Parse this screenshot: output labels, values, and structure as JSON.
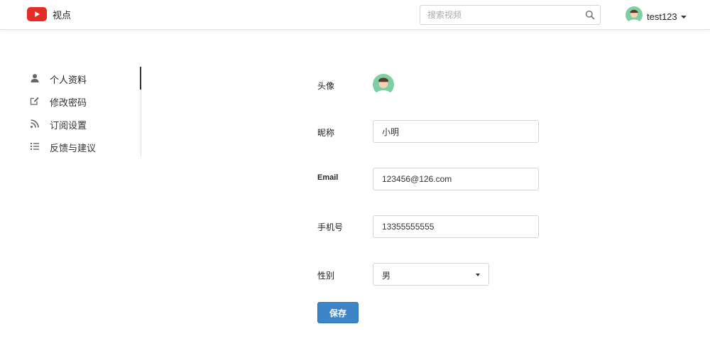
{
  "header": {
    "app_name": "视点",
    "search_placeholder": "搜索视频",
    "search_value": "",
    "username": "test123"
  },
  "sidebar": {
    "items": [
      {
        "label": "个人资料",
        "icon": "user-icon",
        "active": true
      },
      {
        "label": "修改密码",
        "icon": "edit-icon",
        "active": false
      },
      {
        "label": "订阅设置",
        "icon": "rss-icon",
        "active": false
      },
      {
        "label": "反馈与建议",
        "icon": "list-icon",
        "active": false
      }
    ]
  },
  "form": {
    "avatar_label": "头像",
    "nickname_label": "昵称",
    "nickname_value": "小明",
    "email_label": "Email",
    "email_value": "123456@126.com",
    "phone_label": "手机号",
    "phone_value": "13355555555",
    "gender_label": "性别",
    "gender_value": "男",
    "save_label": "保存"
  },
  "colors": {
    "brand": "#e52d27",
    "primary_button": "#3b85c8",
    "avatar_bg": "#7ecfa3"
  }
}
